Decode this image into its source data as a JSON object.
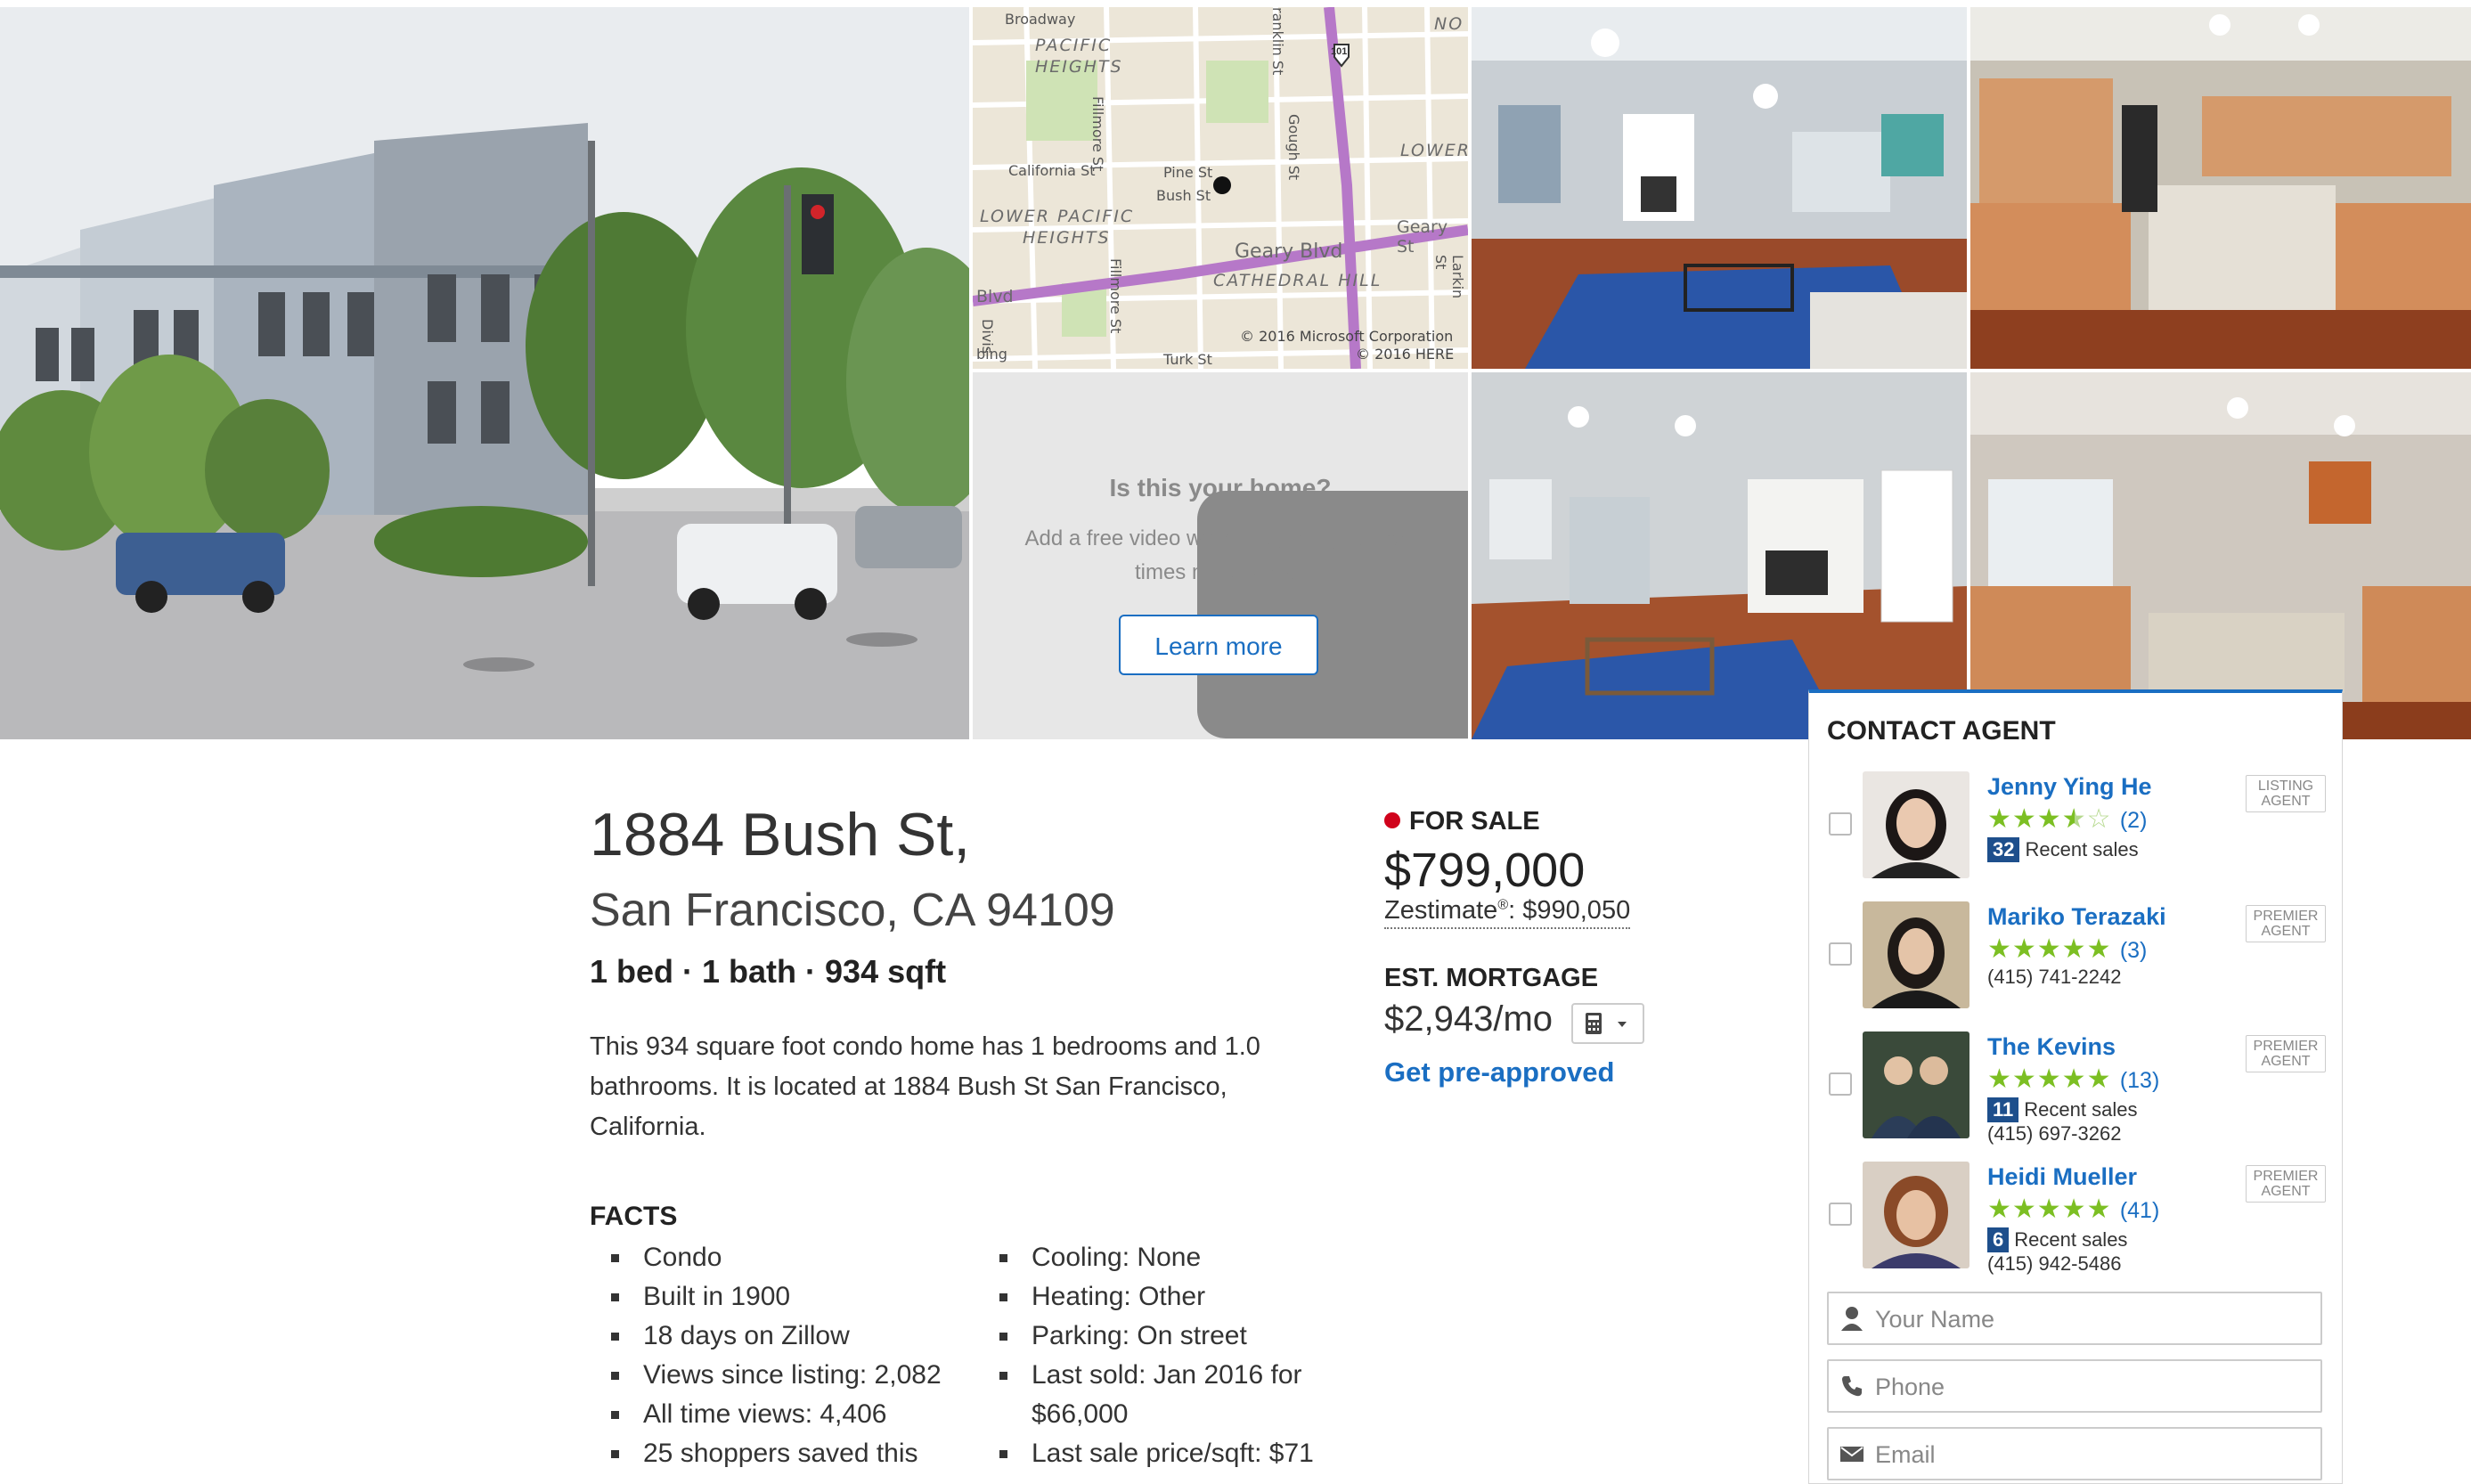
{
  "map": {
    "neighborhoods": [
      "PACIFIC",
      "HEIGHTS",
      "LOWER PACIFIC",
      "HEIGHTS",
      "LOWER",
      "CATHEDRAL HILL",
      "NO"
    ],
    "streets": [
      "Broadway",
      "California St",
      "Pine St",
      "Bush St",
      "Fillmore St",
      "Fillmore St",
      "Gough St",
      "Geary Blvd",
      "Geary St",
      "Larkin St",
      "ranklin St",
      "Blvd",
      "Turk St",
      "Divis"
    ],
    "highway": "101",
    "credits": [
      "© 2016 Microsoft Corporation",
      "© 2016 HERE"
    ],
    "bing": "bing"
  },
  "video": {
    "question": "Is this your home?",
    "subtitle": "Add a free video walkthrough to get three times more views!",
    "button_label": "Learn more"
  },
  "listing": {
    "address_line1": "1884 Bush St,",
    "address_line2": "San Francisco, CA 94109",
    "beds_baths_sqft": "1 bed · 1 bath · 934 sqft",
    "description": "This 934 square foot condo home has 1 bedrooms and 1.0 bathrooms. It is located at 1884 Bush St San Francisco, California.",
    "status": "FOR SALE",
    "status_color": "#d0021b",
    "price": "$799,000",
    "zestimate_label": "Zestimate",
    "zestimate_mark": "®",
    "zestimate_value": ": $990,050",
    "mortgage_heading": "EST. MORTGAGE",
    "mortgage_value": "$2,943/mo",
    "preapproved_link": "Get pre-approved"
  },
  "facts": {
    "heading": "FACTS",
    "left": [
      "Condo",
      "Built in 1900",
      "18 days on Zillow",
      "Views since listing: 2,082",
      "All time views: 4,406",
      "25 shoppers saved this"
    ],
    "right": [
      "Cooling: None",
      "Heating: Other",
      "Parking: On street",
      "Last sold: Jan 2016 for $66,000",
      "Last sale price/sqft: $71"
    ]
  },
  "contact": {
    "title": "CONTACT AGENT",
    "agents": [
      {
        "name": "Jenny Ying He",
        "rating": 3.5,
        "reviews": "(2)",
        "recent_sales_count": "32",
        "recent_sales_label": "Recent sales",
        "phone": "",
        "tag": "LISTING AGENT"
      },
      {
        "name": "Mariko Terazaki",
        "rating": 5,
        "reviews": "(3)",
        "recent_sales_count": "",
        "recent_sales_label": "",
        "phone": "(415) 741-2242",
        "tag": "PREMIER AGENT"
      },
      {
        "name": "The Kevins",
        "rating": 5,
        "reviews": "(13)",
        "recent_sales_count": "11",
        "recent_sales_label": "Recent sales",
        "phone": "(415) 697-3262",
        "tag": "PREMIER AGENT"
      },
      {
        "name": "Heidi Mueller",
        "rating": 5,
        "reviews": "(41)",
        "recent_sales_count": "6",
        "recent_sales_label": "Recent sales",
        "phone": "(415) 942-5486",
        "tag": "PREMIER AGENT"
      }
    ],
    "name_placeholder": "Your Name",
    "phone_placeholder": "Phone",
    "email_placeholder": "Email"
  },
  "colors": {
    "accent": "#1a6ec2",
    "star": "#7cbf23",
    "badge": "#1e4f8c"
  }
}
